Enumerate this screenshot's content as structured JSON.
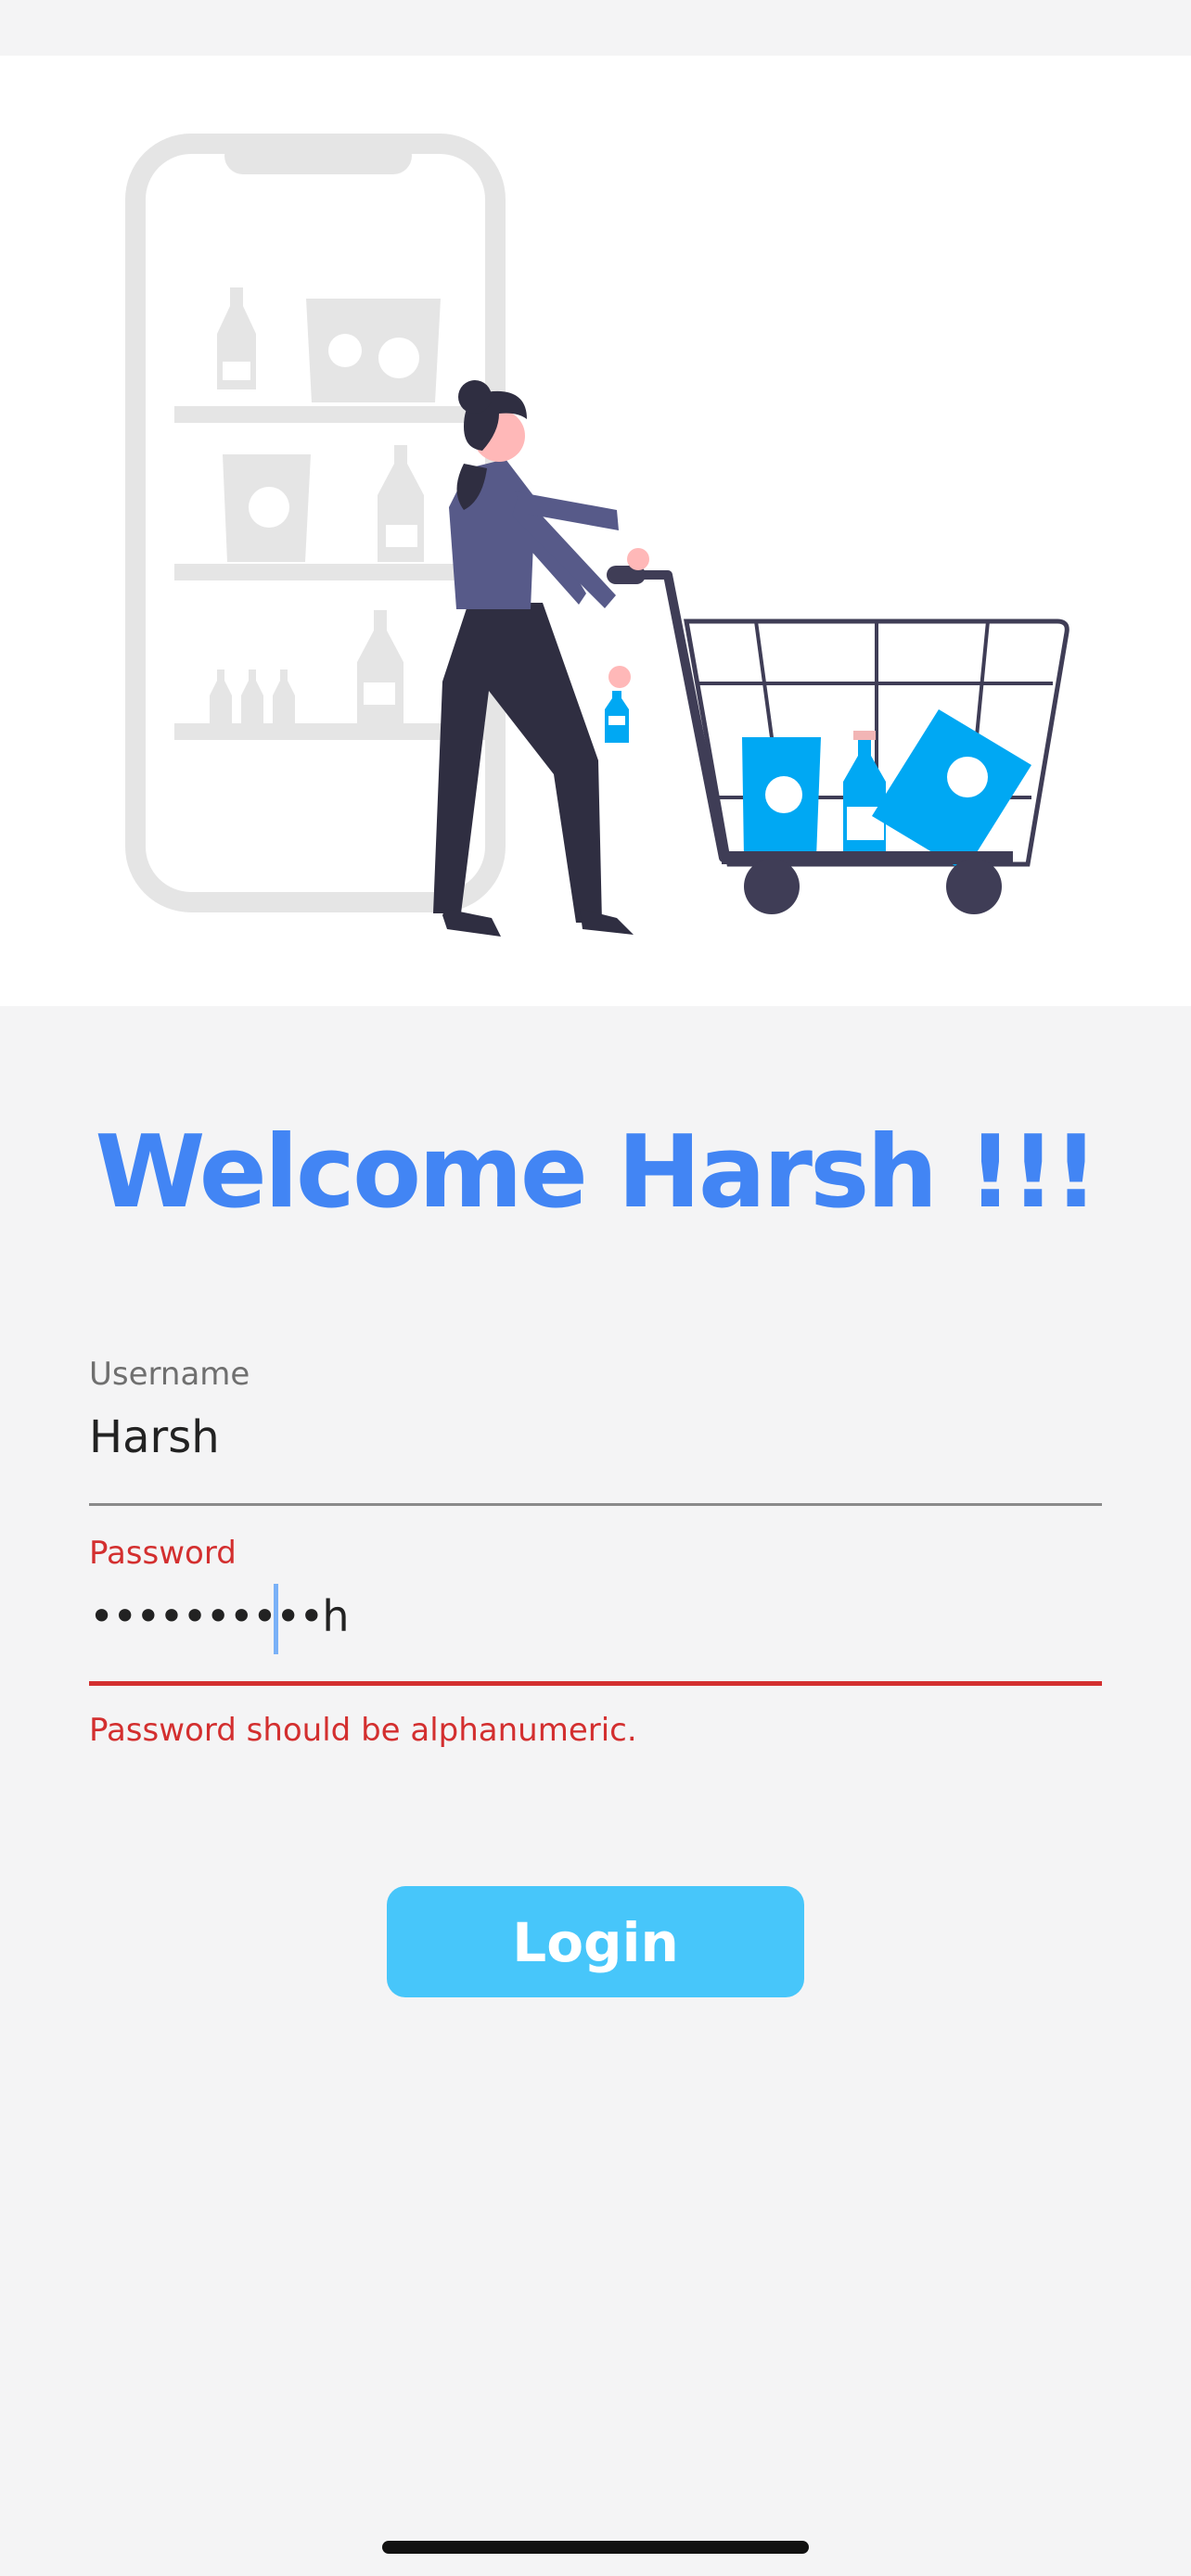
{
  "welcome": {
    "title": "Welcome Harsh !!!"
  },
  "form": {
    "username": {
      "label": "Username",
      "value": "Harsh"
    },
    "password": {
      "label": "Password",
      "value": "••••••••••h",
      "error": "Password should be alphanumeric."
    }
  },
  "actions": {
    "login_label": "Login"
  },
  "colors": {
    "accent": "#4285f4",
    "button": "#47c6fa",
    "error": "#d32f2f",
    "illustration_blue": "#00a8f3",
    "illustration_dark": "#3f3d56"
  },
  "illustration": {
    "name": "shopping-cart-illustration"
  }
}
